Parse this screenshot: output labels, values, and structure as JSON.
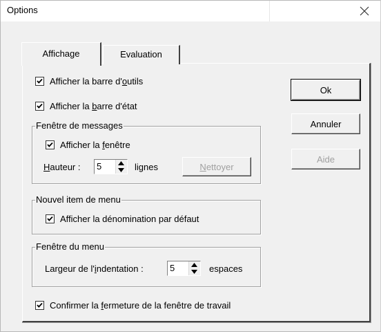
{
  "window": {
    "title": "Options",
    "close_icon": "close-icon"
  },
  "tabs": [
    {
      "label": "Affichage",
      "active": true
    },
    {
      "label": "Evaluation",
      "active": false
    }
  ],
  "options": {
    "show_toolbar": {
      "label_before": "Afficher la barre d'",
      "label_u": "o",
      "label_after": "utils",
      "checked": true
    },
    "show_statusbar": {
      "label_before": "Afficher la ",
      "label_u": "b",
      "label_after": "arre d'état",
      "checked": true
    },
    "confirm_close": {
      "label_before": "Confirmer la ",
      "label_u": "f",
      "label_after": "ermeture de la fenêtre de travail",
      "checked": true
    }
  },
  "messages_group": {
    "title": "Fenêtre de messages",
    "show_window": {
      "label_before": "Afficher la ",
      "label_u": "f",
      "label_after": "enêtre",
      "checked": true
    },
    "height_label_u": "H",
    "height_label_rest": "auteur :",
    "height_value": "5",
    "height_unit": "lignes",
    "clear_button_u": "N",
    "clear_button_rest": "ettoyer"
  },
  "menu_item_group": {
    "title": "Nouvel item de menu",
    "show_name": {
      "label": "Afficher la dénomination par défaut",
      "checked": true
    }
  },
  "menu_window_group": {
    "title": "Fenêtre du menu",
    "indent_label_before": "Largeur de l'",
    "indent_label_u": "i",
    "indent_label_after": "ndentation :",
    "indent_value": "5",
    "indent_unit": "espaces"
  },
  "buttons": {
    "ok": "Ok",
    "cancel": "Annuler",
    "help": "Aide"
  }
}
